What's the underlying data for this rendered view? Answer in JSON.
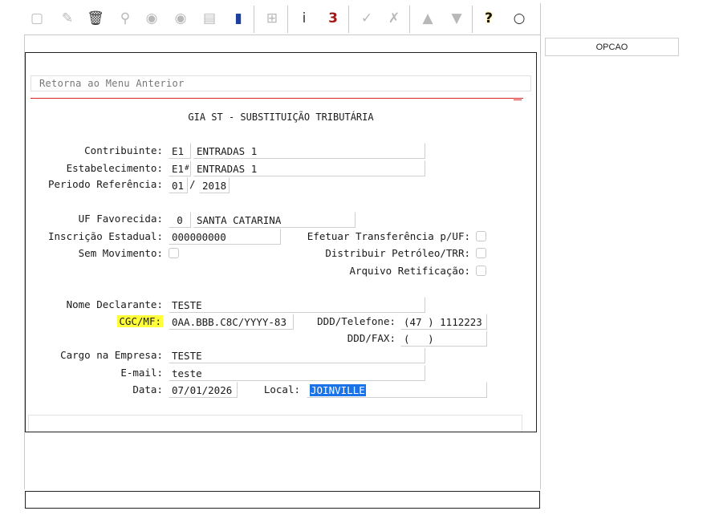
{
  "toolbar": {
    "icons": [
      "new-document-icon",
      "edit-icon",
      "trash-icon",
      "search-icon",
      "previous-icon",
      "next-icon",
      "print-icon",
      "exit-door-icon",
      "binoculars-icon",
      "info-icon",
      "calculator-icon",
      "check-icon",
      "cancel-icon",
      "up-icon",
      "down-icon",
      "help-icon",
      "chat-icon"
    ],
    "glyphs": {
      "new": "▢",
      "edit": "✎",
      "trash": "🗑",
      "search": "⚲",
      "prev": "◉",
      "next": "◉",
      "print": "▤",
      "exit": "▮",
      "binoculars": "⊞",
      "info": "i",
      "calc": "3",
      "check": "✓",
      "cancel": "✗",
      "up": "▲",
      "down": "▼",
      "help": "?",
      "chat": "○"
    }
  },
  "side": {
    "opcao_label": "OPCAO"
  },
  "menu": {
    "back_label": "Retorna ao Menu Anterior"
  },
  "form": {
    "title": "GIA ST - SUBSTITUIÇÃO TRIBUTÁRIA",
    "contribuinte": {
      "label": "Contribuinte:",
      "code": "E1",
      "name": "ENTRADAS 1"
    },
    "estabelecimento": {
      "label": "Estabelecimento:",
      "code": "E1",
      "marker": "#",
      "name": "ENTRADAS 1"
    },
    "periodo": {
      "label": "Periodo Referência:",
      "month": "01",
      "sep": "/",
      "year": "2018"
    },
    "uf": {
      "label": "UF Favorecida:",
      "code": "0",
      "name": "SANTA CATARINA"
    },
    "inscricao": {
      "label": "Inscrição Estadual:",
      "value": "000000000"
    },
    "transferencia": {
      "label": "Efetuar Transferência p/UF:"
    },
    "sem_movimento": {
      "label": "Sem Movimento:"
    },
    "petroleo": {
      "label": "Distribuir Petróleo/TRR:"
    },
    "retificacao": {
      "label": "Arquivo Retificação:"
    },
    "nome": {
      "label": "Nome Declarante:",
      "value": "TESTE"
    },
    "cgc": {
      "label": "CGC/MF:",
      "value": "0AA.BBB.C8C/YYYY-83"
    },
    "telefone": {
      "label": "DDD/Telefone:",
      "value": "(47 ) 1112223"
    },
    "fax": {
      "label": "DDD/FAX:",
      "value": "(   )"
    },
    "cargo": {
      "label": "Cargo na Empresa:",
      "value": "TESTE"
    },
    "email": {
      "label": "E-mail:",
      "value": "teste"
    },
    "data": {
      "label": "Data:",
      "value": "07/01/2026"
    },
    "local": {
      "label": "Local:",
      "value": "JOINVILLE"
    }
  },
  "colors": {
    "highlight": "#ffff3a",
    "selection": "#1a73e8",
    "divider": "#dd2222"
  }
}
